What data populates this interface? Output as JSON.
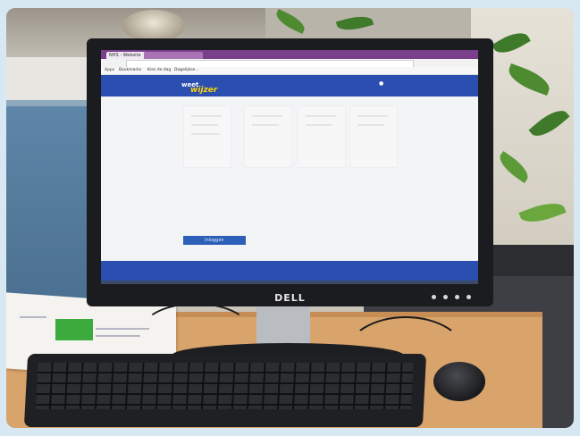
{
  "monitor": {
    "brand": "DELL"
  },
  "browser": {
    "tabs": [
      "NHS - Website",
      "x",
      "x"
    ],
    "bookmarks": [
      "Apps",
      "Bookmarks",
      "Kies de dag",
      "Dagelijkse..."
    ]
  },
  "site": {
    "logo_top": "weet",
    "logo_bottom": "wijzer",
    "login_button": "Inloggen"
  },
  "colors": {
    "site_blue": "#2b4fb0",
    "browser_purple": "#7a3f8a",
    "login_blue": "#2b5fb8"
  }
}
